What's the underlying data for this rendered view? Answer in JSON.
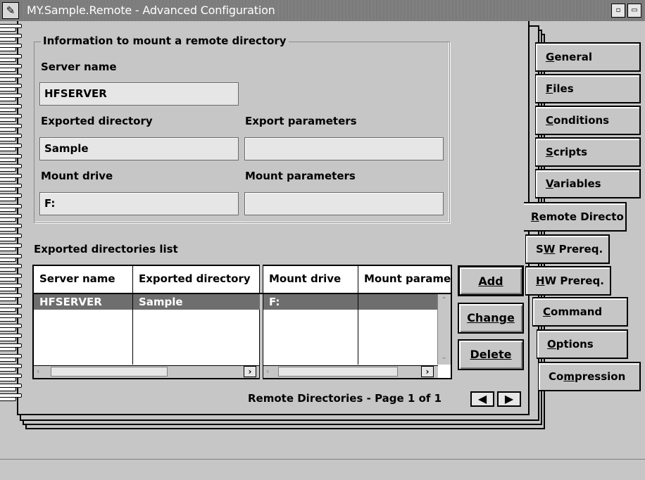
{
  "window": {
    "title": "MY.Sample.Remote - Advanced Configuration",
    "sysmenu_icon": "notepad-icon",
    "minimize_glyph": "▫",
    "restore_glyph": "▭"
  },
  "group": {
    "title": "Information to mount a remote directory",
    "server_name_label": "Server name",
    "server_name_value": "HFSERVER",
    "exported_dir_label": "Exported directory",
    "exported_dir_value": "Sample",
    "export_params_label": "Export parameters",
    "export_params_value": "",
    "mount_drive_label": "Mount drive",
    "mount_drive_value": "F:",
    "mount_params_label": "Mount parameters",
    "mount_params_value": ""
  },
  "list": {
    "label": "Exported directories list",
    "columns": [
      "Server name",
      "Exported directory",
      "Mount drive",
      "Mount parame"
    ],
    "rows": [
      [
        "HFSERVER",
        "Sample",
        "F:",
        ""
      ]
    ]
  },
  "buttons": {
    "add": "Add",
    "change": "Change",
    "delete": "Delete"
  },
  "pager": {
    "text": "Remote Directories - Page 1 of 1",
    "prev_glyph": "🡐",
    "next_glyph": "🡒"
  },
  "tabs": [
    {
      "label": "General",
      "active": false
    },
    {
      "label": "Files",
      "active": false
    },
    {
      "label": "Conditions",
      "active": false
    },
    {
      "label": "Scripts",
      "active": false
    },
    {
      "label": "Variables",
      "active": false
    },
    {
      "label": "Remote Directo",
      "active": true
    },
    {
      "label": "SW Prereq.",
      "active": false
    },
    {
      "label": "HW Prereq.",
      "active": false
    },
    {
      "label": "Command",
      "active": false
    },
    {
      "label": "Options",
      "active": false
    },
    {
      "label": "Compression",
      "active": false
    }
  ],
  "colors": {
    "face": "#c6c6c6",
    "selection": "#6e6e6e",
    "field": "#e6e6e6"
  }
}
